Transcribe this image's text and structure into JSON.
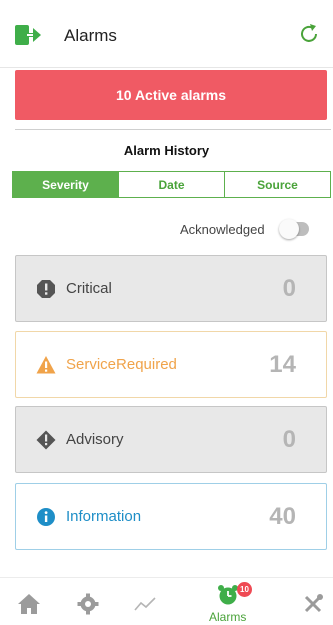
{
  "header": {
    "title": "Alarms",
    "exit_icon": "exit-icon",
    "refresh_icon": "refresh-icon"
  },
  "active_banner": {
    "text": "10 Active alarms",
    "color": "#f05a64"
  },
  "history": {
    "title": "Alarm History",
    "tabs": [
      {
        "label": "Severity",
        "active": true
      },
      {
        "label": "Date",
        "active": false
      },
      {
        "label": "Source",
        "active": false
      }
    ],
    "acknowledged_label": "Acknowledged",
    "acknowledged_on": false
  },
  "cards": [
    {
      "label": "Critical",
      "count": "0",
      "icon": "critical-icon"
    },
    {
      "label": "ServiceRequired",
      "count": "14",
      "icon": "warning-icon"
    },
    {
      "label": "Advisory",
      "count": "0",
      "icon": "advisory-icon"
    },
    {
      "label": "Information",
      "count": "40",
      "icon": "info-icon"
    }
  ],
  "bottom_nav": {
    "items": [
      "home-icon",
      "settings-icon",
      "trend-icon",
      "alarms-icon",
      "tools-icon"
    ],
    "alarms_label": "Alarms",
    "alarms_badge": "10"
  },
  "colors": {
    "accent": "#5db04d",
    "alert": "#f05a64",
    "warning": "#f0a34a",
    "info": "#1e8ec7"
  }
}
